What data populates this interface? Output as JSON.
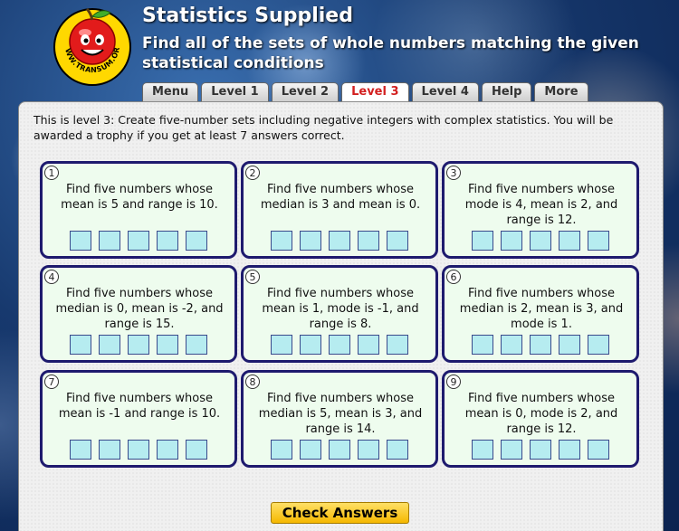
{
  "header": {
    "title": "Statistics Supplied",
    "subtitle": "Find all of the sets of whole numbers matching the given statistical conditions",
    "logo_text": "WWW.TRANSUM.ORG"
  },
  "tabs": [
    {
      "label": "Menu",
      "active": false
    },
    {
      "label": "Level 1",
      "active": false
    },
    {
      "label": "Level 2",
      "active": false
    },
    {
      "label": "Level 3",
      "active": true
    },
    {
      "label": "Level 4",
      "active": false
    },
    {
      "label": "Help",
      "active": false
    },
    {
      "label": "More",
      "active": false
    }
  ],
  "intro": "This is level 3: Create five-number sets including negative integers with complex statistics. You will be awarded a trophy if you get at least 7 answers correct.",
  "questions": [
    {
      "number": "1",
      "text": "Find five numbers whose mean is 5 and range is 10."
    },
    {
      "number": "2",
      "text": "Find five numbers whose median is 3 and mean is 0."
    },
    {
      "number": "3",
      "text": "Find five numbers whose mode is 4, mean is 2, and range is 12."
    },
    {
      "number": "4",
      "text": "Find five numbers whose median is 0, mean is -2, and range is 15."
    },
    {
      "number": "5",
      "text": "Find five numbers whose mean is 1, mode is -1, and range is 8."
    },
    {
      "number": "6",
      "text": "Find five numbers whose median is 2, mean is 3, and mode is 1."
    },
    {
      "number": "7",
      "text": "Find five numbers whose mean is -1 and range is 10."
    },
    {
      "number": "8",
      "text": "Find five numbers whose median is 5, mean is 3, and range is 14."
    },
    {
      "number": "9",
      "text": "Find five numbers whose mean is 0, mode is 2, and range is 12."
    }
  ],
  "check_button": "Check Answers",
  "colors": {
    "card_border": "#1e1a6e",
    "card_bg": "#eefcee",
    "answer_box": "#b6ecf0",
    "active_tab_text": "#d32020",
    "button": "#f5b800"
  }
}
